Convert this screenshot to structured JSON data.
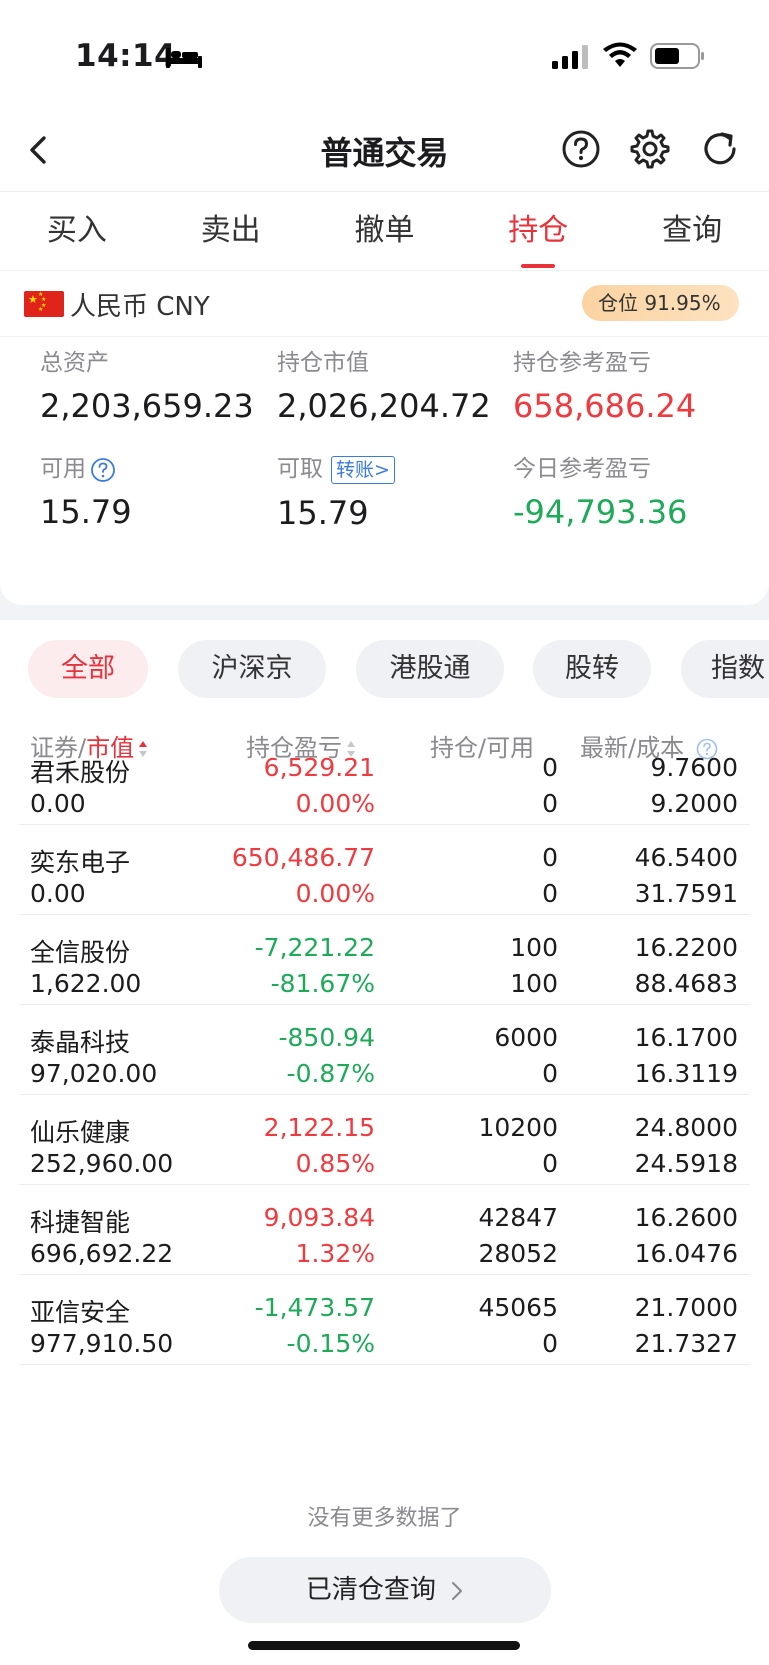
{
  "status_bar": {
    "time": "14:14"
  },
  "nav": {
    "title": "普通交易"
  },
  "tabs": [
    "买入",
    "卖出",
    "撤单",
    "持仓",
    "查询"
  ],
  "active_tab": "持仓",
  "account": {
    "currency": "人民币 CNY",
    "position_ratio": "仓位 91.95%",
    "total_assets_label": "总资产",
    "total_assets": "2,203,659.23",
    "market_value_label": "持仓市值",
    "market_value": "2,026,204.72",
    "position_pl_label": "持仓参考盈亏",
    "position_pl": "658,686.24",
    "available_label": "可用",
    "available": "15.79",
    "withdrawable_label": "可取",
    "transfer_label": "转账>",
    "withdrawable": "15.79",
    "today_pl_label": "今日参考盈亏",
    "today_pl": "-94,793.36"
  },
  "filters": [
    "全部",
    "沪深京",
    "港股通",
    "股转",
    "指数"
  ],
  "columns": {
    "security": "证券",
    "market_value": "市值",
    "pl": "持仓盈亏",
    "qty": "持仓",
    "available": "可用",
    "latest": "最新",
    "cost": "成本",
    "sep": "/"
  },
  "positions": [
    {
      "name": "君禾股份",
      "market_value": "0.00",
      "pl": "6,529.21",
      "pl_pct": "0.00%",
      "qty": "0",
      "avail": "0",
      "latest": "9.7600",
      "cost": "9.2000",
      "trend": "up"
    },
    {
      "name": "奕东电子",
      "market_value": "0.00",
      "pl": "650,486.77",
      "pl_pct": "0.00%",
      "qty": "0",
      "avail": "0",
      "latest": "46.5400",
      "cost": "31.7591",
      "trend": "up"
    },
    {
      "name": "全信股份",
      "market_value": "1,622.00",
      "pl": "-7,221.22",
      "pl_pct": "-81.67%",
      "qty": "100",
      "avail": "100",
      "latest": "16.2200",
      "cost": "88.4683",
      "trend": "down"
    },
    {
      "name": "泰晶科技",
      "market_value": "97,020.00",
      "pl": "-850.94",
      "pl_pct": "-0.87%",
      "qty": "6000",
      "avail": "0",
      "latest": "16.1700",
      "cost": "16.3119",
      "trend": "down"
    },
    {
      "name": "仙乐健康",
      "market_value": "252,960.00",
      "pl": "2,122.15",
      "pl_pct": "0.85%",
      "qty": "10200",
      "avail": "0",
      "latest": "24.8000",
      "cost": "24.5918",
      "trend": "up"
    },
    {
      "name": "科捷智能",
      "market_value": "696,692.22",
      "pl": "9,093.84",
      "pl_pct": "1.32%",
      "qty": "42847",
      "avail": "28052",
      "latest": "16.2600",
      "cost": "16.0476",
      "trend": "up"
    },
    {
      "name": "亚信安全",
      "market_value": "977,910.50",
      "pl": "-1,473.57",
      "pl_pct": "-0.15%",
      "qty": "45065",
      "avail": "0",
      "latest": "21.7000",
      "cost": "21.7327",
      "trend": "down"
    }
  ],
  "footer": {
    "no_more": "没有更多数据了",
    "closed_query": "已清仓查询"
  },
  "colors": {
    "up": "#ef3b3f",
    "down": "#1faa5a",
    "accent": "#e8323a"
  }
}
